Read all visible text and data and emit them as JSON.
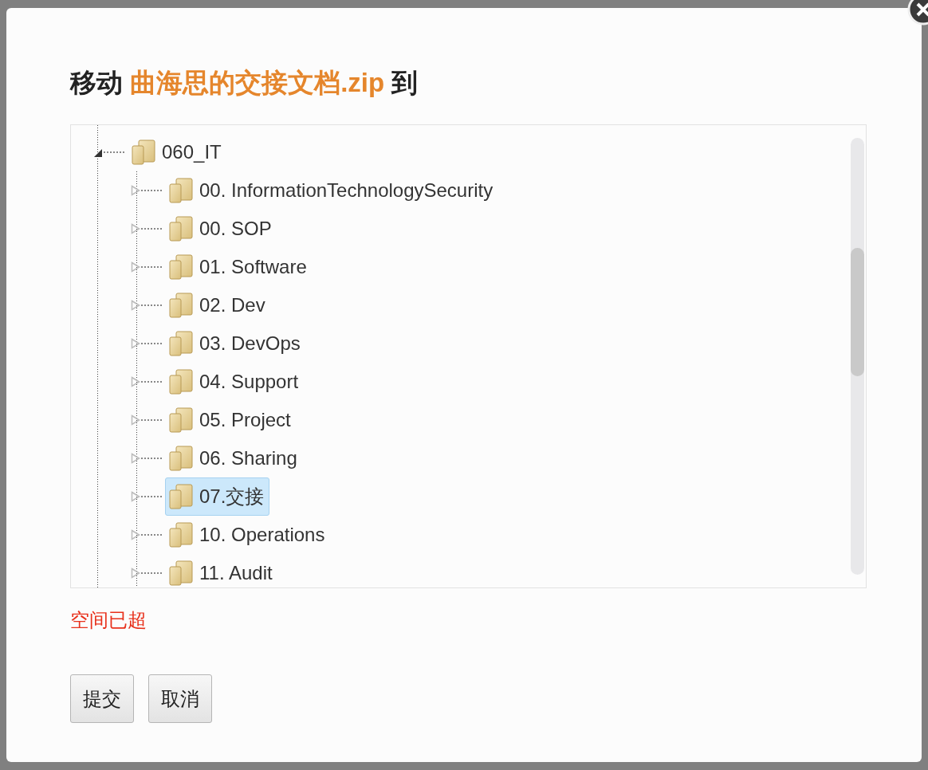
{
  "dialog": {
    "title": {
      "prefix": "移动",
      "file_name": "曲海思的交接文档.zip",
      "suffix": "到"
    },
    "tree": [
      {
        "label": "060_IT",
        "expanded": true,
        "selected": false,
        "children": [
          {
            "label": "00. InformationTechnologySecurity",
            "expanded": false,
            "selected": false
          },
          {
            "label": "00. SOP",
            "expanded": false,
            "selected": false
          },
          {
            "label": "01. Software",
            "expanded": false,
            "selected": false
          },
          {
            "label": "02. Dev",
            "expanded": false,
            "selected": false
          },
          {
            "label": "03. DevOps",
            "expanded": false,
            "selected": false
          },
          {
            "label": "04. Support",
            "expanded": false,
            "selected": false
          },
          {
            "label": "05. Project",
            "expanded": false,
            "selected": false
          },
          {
            "label": "06. Sharing",
            "expanded": false,
            "selected": false
          },
          {
            "label": "07.交接",
            "expanded": false,
            "selected": true
          },
          {
            "label": "10. Operations",
            "expanded": false,
            "selected": false
          },
          {
            "label": "11. Audit",
            "expanded": false,
            "selected": false
          }
        ]
      }
    ],
    "error": "空间已超",
    "buttons": [
      "提交",
      "取消"
    ]
  }
}
